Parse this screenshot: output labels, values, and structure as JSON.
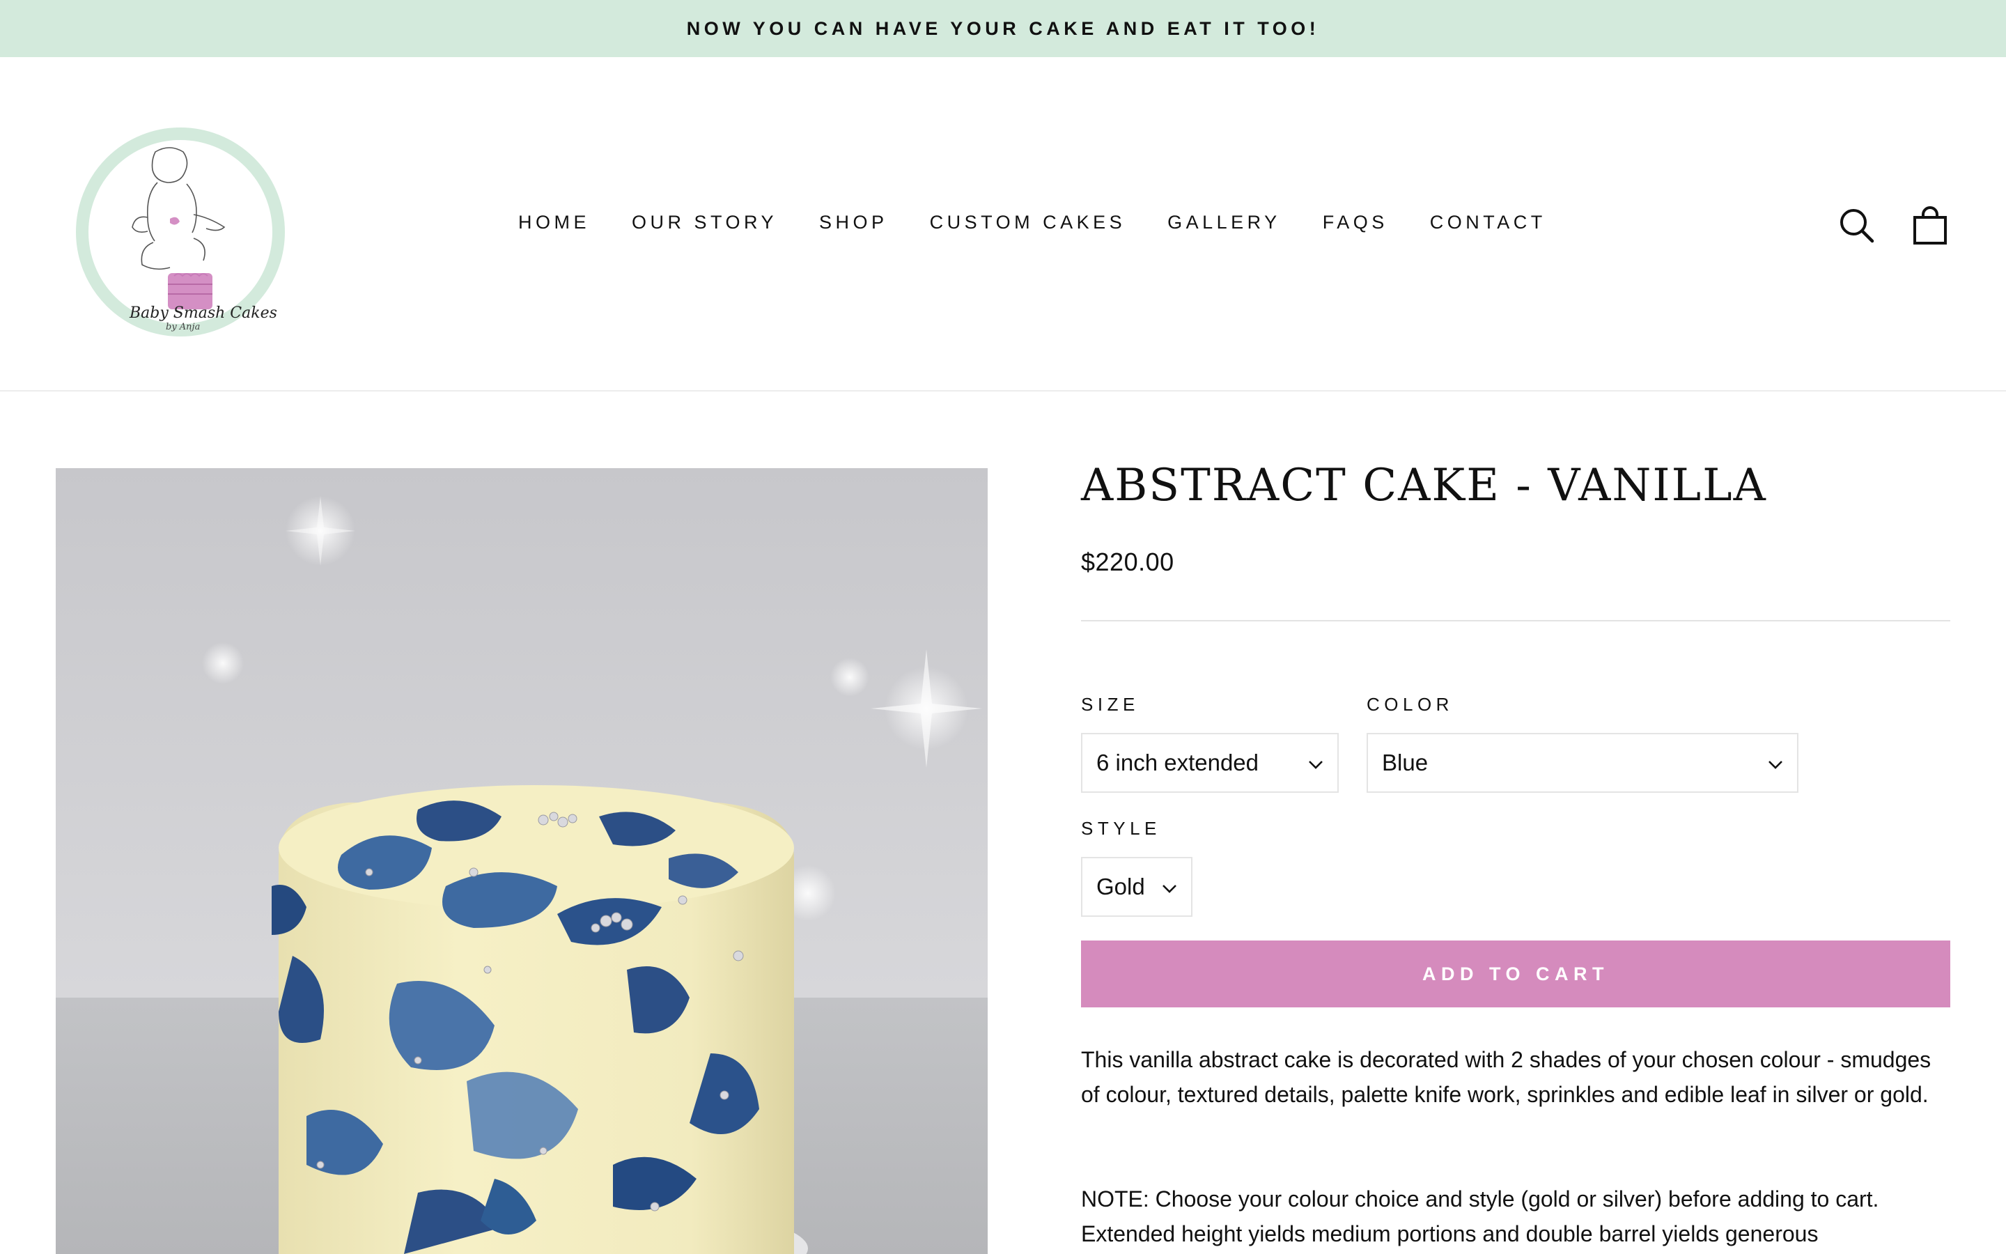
{
  "announcement": {
    "text": "NOW YOU CAN HAVE YOUR CAKE AND EAT IT TOO!"
  },
  "header": {
    "logo_text": "Baby Smash Cakes",
    "logo_subtext": "by Anja",
    "nav": [
      {
        "label": "HOME"
      },
      {
        "label": "OUR STORY"
      },
      {
        "label": "SHOP"
      },
      {
        "label": "CUSTOM CAKES"
      },
      {
        "label": "GALLERY"
      },
      {
        "label": "FAQS"
      },
      {
        "label": "CONTACT"
      }
    ],
    "icons": {
      "search": "search-icon",
      "cart": "shopping-bag-icon"
    }
  },
  "product": {
    "title": "ABSTRACT CAKE - VANILLA",
    "price": "$220.00",
    "options": {
      "size": {
        "label": "SIZE",
        "value": "6 inch extended"
      },
      "color": {
        "label": "COLOR",
        "value": "Blue"
      },
      "style": {
        "label": "STYLE",
        "value": "Gold"
      }
    },
    "add_to_cart": "ADD TO CART",
    "description": [
      "This vanilla abstract cake is decorated with 2 shades of your chosen colour - smudges of colour, textured details, palette knife work, sprinkles and edible leaf in silver or gold.",
      "NOTE: Choose your colour choice and style (gold or silver) before adding to cart. Extended height yields medium portions and double barrel yields generous"
    ]
  },
  "colors": {
    "announcement_bg": "#d3eadc",
    "add_to_cart_bg": "#d58bbd",
    "logo_ring": "#d3eadc",
    "cake_accent": "#d48fc4"
  }
}
